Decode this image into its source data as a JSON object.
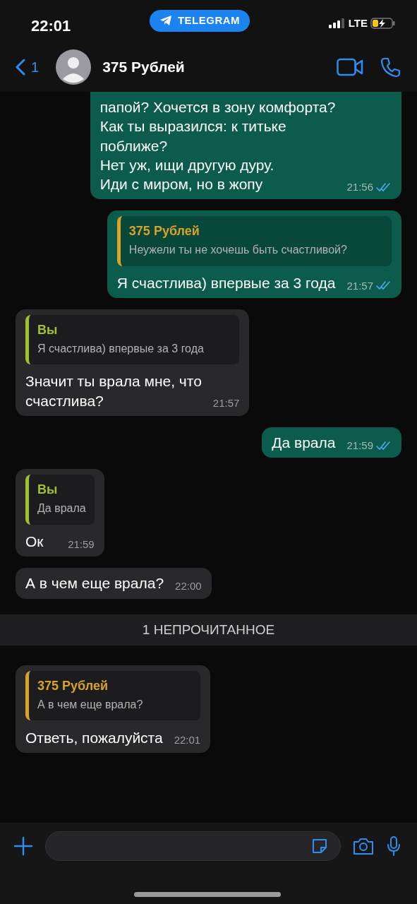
{
  "status_bar": {
    "time": "22:01",
    "back_app": "TELEGRAM",
    "network": "LTE"
  },
  "header": {
    "back_count": "1",
    "contact_name": "375 Рублей"
  },
  "messages": [
    {
      "outgoing": true,
      "clipped": true,
      "text": "папой? Хочется в зону комфорта?\nКак ты выразился: к титьке\nпоближе?\nНет уж, ищи другую дуру.\nИди с миром, но в жопу",
      "time": "21:56",
      "read": true
    },
    {
      "outgoing": true,
      "clipped": false,
      "quote": {
        "author": "375 Рублей",
        "text": "Неужели ты не хочешь быть счастливой?",
        "color": "#d9a326"
      },
      "text": "Я счастлива) впервые за 3 года",
      "time": "21:57",
      "read": true
    },
    {
      "outgoing": false,
      "clipped": false,
      "quote": {
        "author": "Вы",
        "text": "Я счастлива) впервые за 3 года",
        "color": "#a2c12e"
      },
      "text": "Значит ты врала мне, что\nсчастлива?",
      "time": "21:57"
    },
    {
      "outgoing": true,
      "clipped": false,
      "text": "Да врала",
      "time": "21:59",
      "read": true
    },
    {
      "outgoing": false,
      "clipped": false,
      "quote": {
        "author": "Вы",
        "text": "Да врала",
        "color": "#a2c12e"
      },
      "text": "Ок",
      "time": "21:59"
    },
    {
      "outgoing": false,
      "clipped": false,
      "text": "А в чем еще врала?",
      "time": "22:00"
    },
    {
      "kind": "divider",
      "text": "1 НЕПРОЧИТАННОЕ"
    },
    {
      "outgoing": false,
      "clipped": false,
      "quote": {
        "author": "375 Рублей",
        "text": "А в чем еще врала?",
        "color": "#d9a326"
      },
      "text": "Ответь, пожалуйста",
      "time": "22:01"
    }
  ]
}
